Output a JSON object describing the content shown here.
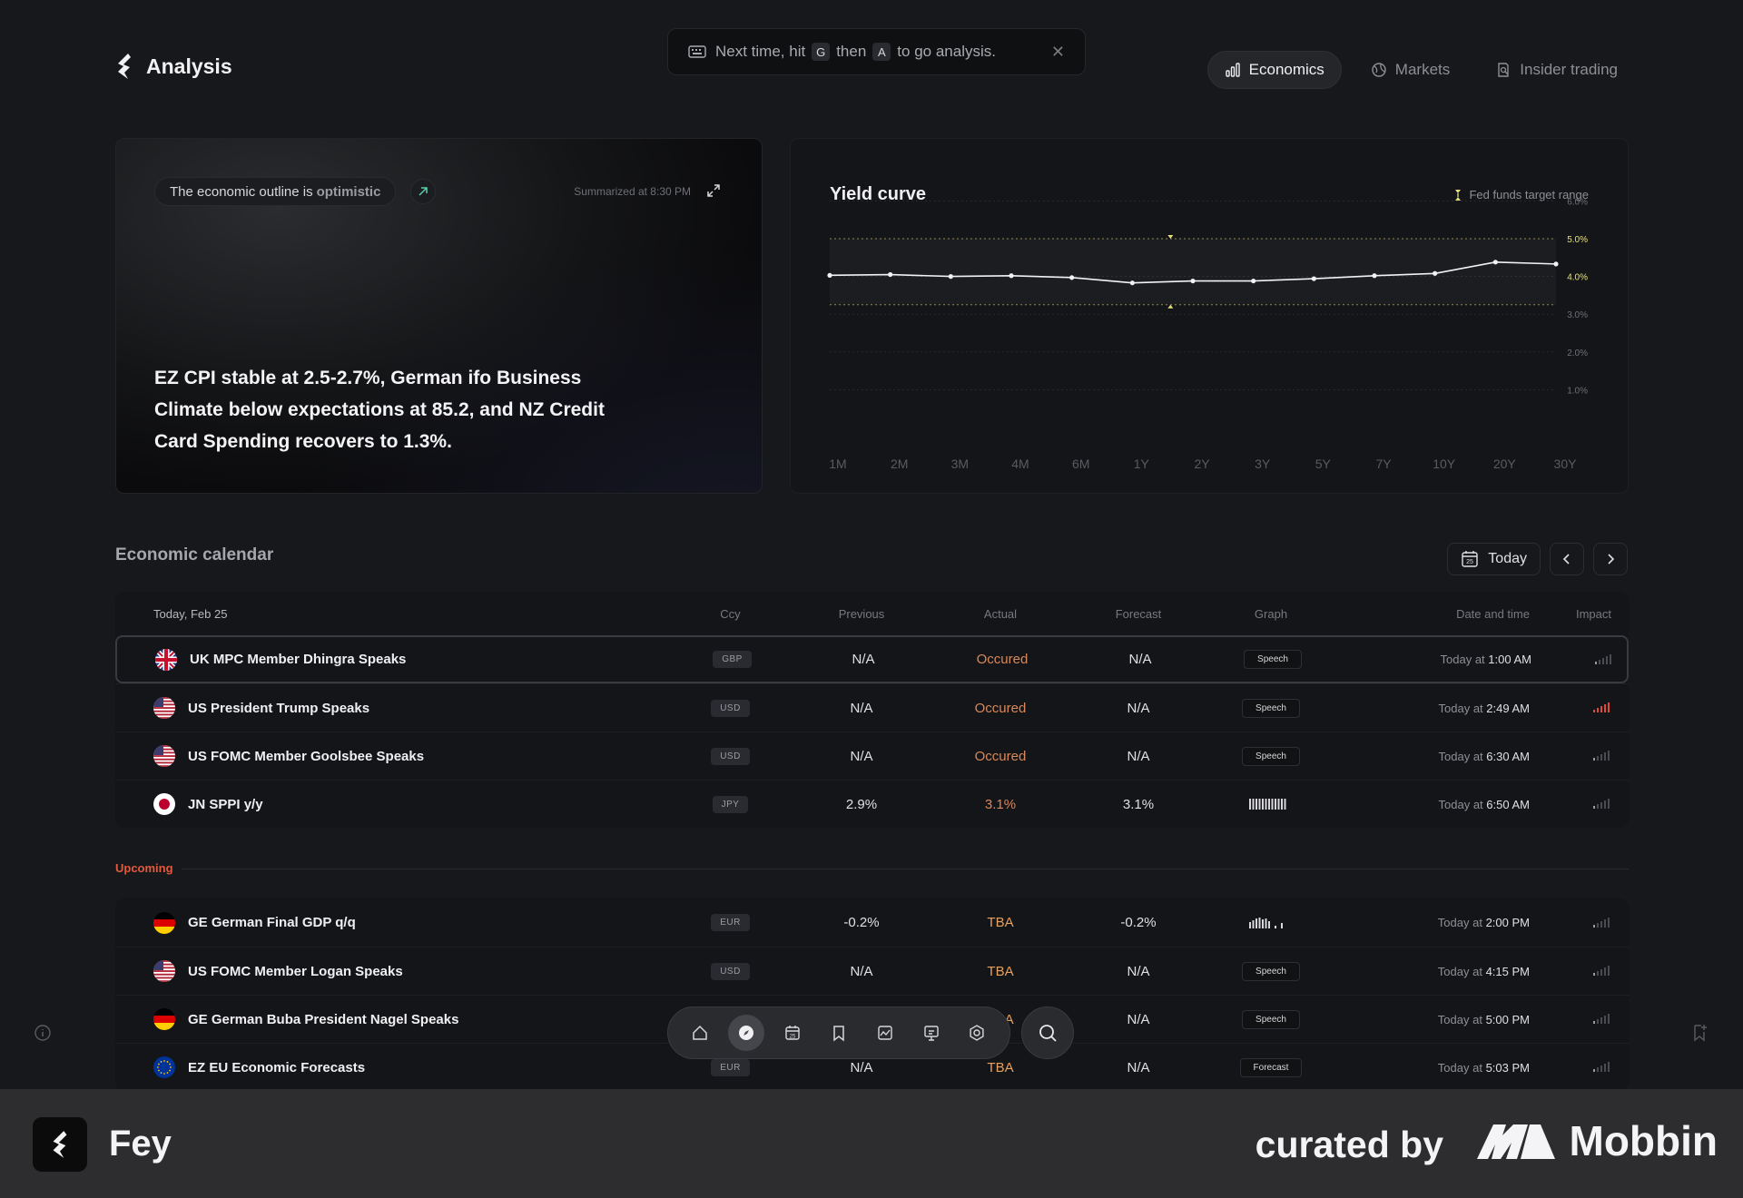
{
  "app": {
    "title": "Analysis"
  },
  "hint": {
    "prefix": "Next time, hit",
    "key1": "G",
    "middle": "then",
    "key2": "A",
    "suffix": "to go analysis."
  },
  "nav": {
    "tabs": [
      {
        "label": "Economics"
      },
      {
        "label": "Markets"
      },
      {
        "label": "Insider trading"
      }
    ]
  },
  "summary": {
    "outline_prefix": "The economic outline is",
    "outline_word": "optimistic",
    "time": "Summarized at 8:30 PM",
    "text": "EZ CPI stable at 2.5-2.7%, German ifo Business Climate below expectations at 85.2, and NZ Credit Card Spending recovers to 1.3%."
  },
  "yield": {
    "title": "Yield curve",
    "legend": "Fed funds target range",
    "accent": "#e6e07a"
  },
  "chart_data": {
    "type": "line",
    "title": "Yield curve",
    "categories": [
      "1M",
      "2M",
      "3M",
      "4M",
      "6M",
      "1Y",
      "2Y",
      "3Y",
      "5Y",
      "7Y",
      "10Y",
      "20Y",
      "30Y"
    ],
    "values": [
      4.03,
      4.05,
      4.0,
      4.02,
      3.97,
      3.83,
      3.88,
      3.88,
      3.94,
      4.02,
      4.08,
      4.38,
      4.33
    ],
    "band": [
      3.25,
      5.0
    ],
    "ylim": [
      0,
      6.5
    ],
    "yticks": [
      "6.0%",
      "5.0%",
      "4.0%",
      "3.0%",
      "2.0%",
      "1.0%"
    ],
    "ytick_values": [
      6,
      5,
      4,
      3,
      2,
      1
    ]
  },
  "calendar": {
    "title": "Economic calendar",
    "today_label": "Today",
    "today_day": "25",
    "headers": {
      "date": "Today, Feb 25",
      "ccy": "Ccy",
      "prev": "Previous",
      "act": "Actual",
      "fore": "Forecast",
      "graph": "Graph",
      "datetime": "Date and time",
      "impact": "Impact"
    },
    "today_rows": [
      {
        "flag": "uk",
        "name": "UK MPC Member Dhingra Speaks",
        "ccy": "GBP",
        "prev": "N/A",
        "act": "Occured",
        "fore": "N/A",
        "graph": "Speech",
        "date_prefix": "Today at",
        "time": "1:00 AM",
        "impact": 1
      },
      {
        "flag": "us",
        "name": "US President Trump Speaks",
        "ccy": "USD",
        "prev": "N/A",
        "act": "Occured",
        "fore": "N/A",
        "graph": "Speech",
        "date_prefix": "Today at",
        "time": "2:49 AM",
        "impact": 3
      },
      {
        "flag": "us",
        "name": "US FOMC Member Goolsbee Speaks",
        "ccy": "USD",
        "prev": "N/A",
        "act": "Occured",
        "fore": "N/A",
        "graph": "Speech",
        "date_prefix": "Today at",
        "time": "6:30 AM",
        "impact": 1
      },
      {
        "flag": "jp",
        "name": "JN SPPI y/y",
        "ccy": "JPY",
        "prev": "2.9%",
        "act": "3.1%",
        "fore": "3.1%",
        "graph": "",
        "date_prefix": "Today at",
        "time": "6:50 AM",
        "impact": 1
      }
    ],
    "upcoming_label": "Upcoming",
    "upcoming_rows": [
      {
        "flag": "de",
        "name": "GE German Final GDP q/q",
        "ccy": "EUR",
        "prev": "-0.2%",
        "act": "TBA",
        "fore": "-0.2%",
        "graph": "",
        "date_prefix": "Today at",
        "time": "2:00 PM",
        "impact": 1
      },
      {
        "flag": "us",
        "name": "US FOMC Member Logan Speaks",
        "ccy": "USD",
        "prev": "N/A",
        "act": "TBA",
        "fore": "N/A",
        "graph": "Speech",
        "date_prefix": "Today at",
        "time": "4:15 PM",
        "impact": 1
      },
      {
        "flag": "de",
        "name": "GE German Buba President Nagel Speaks",
        "ccy": "EUR",
        "prev": "N/A",
        "act": "TBA",
        "fore": "N/A",
        "graph": "Speech",
        "date_prefix": "Today at",
        "time": "5:00 PM",
        "impact": 1
      },
      {
        "flag": "eu",
        "name": "EZ EU Economic Forecasts",
        "ccy": "EUR",
        "prev": "N/A",
        "act": "TBA",
        "fore": "N/A",
        "graph": "Forecast",
        "date_prefix": "Today at",
        "time": "5:03 PM",
        "impact": 1
      }
    ]
  },
  "dock": {
    "items": [
      "home-icon",
      "compass-icon",
      "calendar-icon",
      "bookmark-icon",
      "chart-icon",
      "presentation-icon",
      "settings-icon"
    ],
    "dock_day": "25"
  },
  "footer": {
    "brand": "Fey",
    "curated": "curated by",
    "mobbin": "Mobbin"
  }
}
